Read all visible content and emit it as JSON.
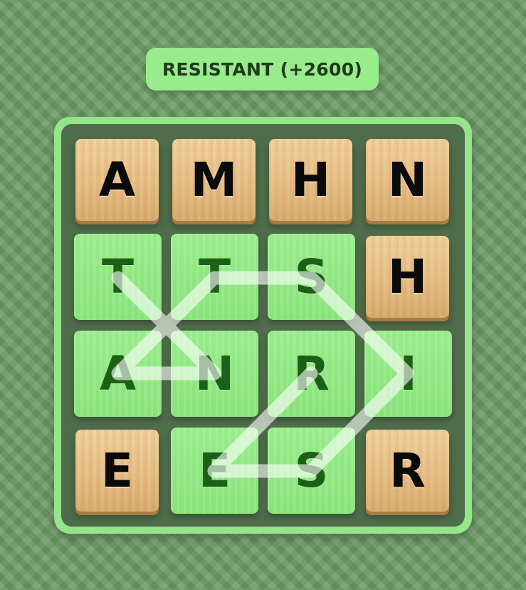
{
  "found_word": {
    "text": "RESISTANT (+2600)"
  },
  "board": {
    "tiles": [
      {
        "letter": "A",
        "state": "wood"
      },
      {
        "letter": "M",
        "state": "wood"
      },
      {
        "letter": "H",
        "state": "wood"
      },
      {
        "letter": "N",
        "state": "wood"
      },
      {
        "letter": "T",
        "state": "selected"
      },
      {
        "letter": "T",
        "state": "selected"
      },
      {
        "letter": "S",
        "state": "selected"
      },
      {
        "letter": "H",
        "state": "wood"
      },
      {
        "letter": "A",
        "state": "selected"
      },
      {
        "letter": "N",
        "state": "selected"
      },
      {
        "letter": "R",
        "state": "selected"
      },
      {
        "letter": "I",
        "state": "selected"
      },
      {
        "letter": "E",
        "state": "wood"
      },
      {
        "letter": "E",
        "state": "selected"
      },
      {
        "letter": "S",
        "state": "selected"
      },
      {
        "letter": "R",
        "state": "wood"
      }
    ]
  },
  "colors": {
    "background": "#6d9a66",
    "pill": "#98ec8c",
    "board_border": "#95e48a",
    "board_inner": "#4f6d4a",
    "wood_tile": "#e6bd83",
    "selected_tile": "#8ee680",
    "selected_letter": "#1d5f16",
    "path": "#ffffff"
  }
}
